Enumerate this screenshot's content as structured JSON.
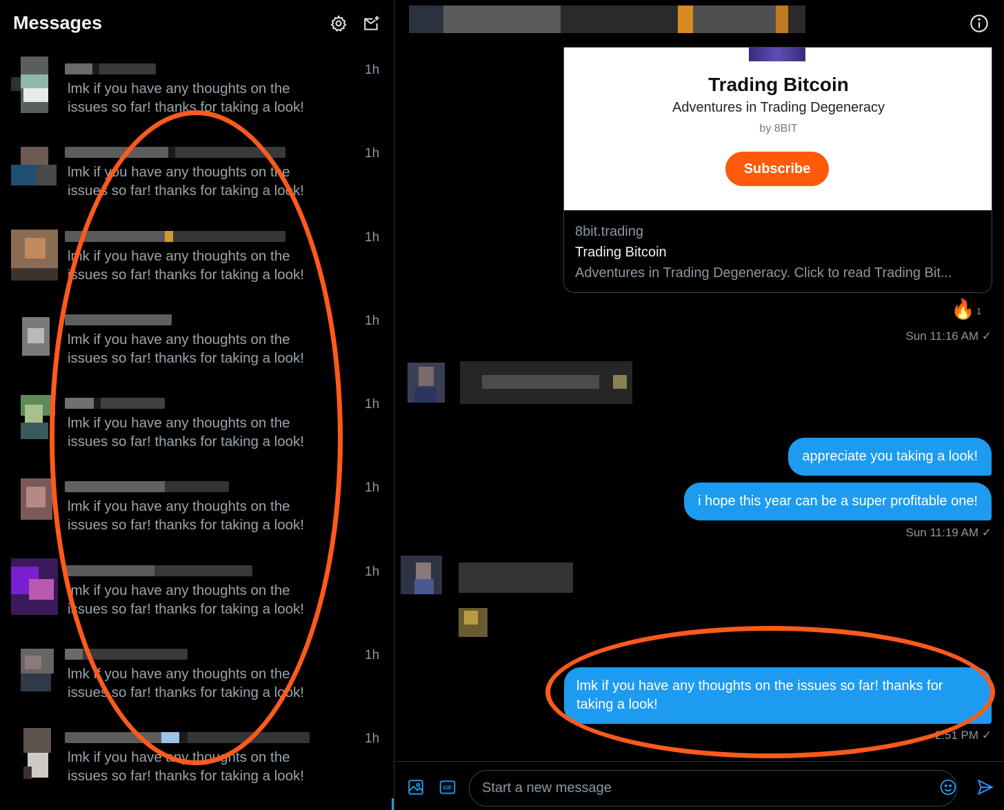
{
  "sidebar": {
    "title": "Messages",
    "settings_icon": "gear-icon",
    "compose_icon": "new-message-icon",
    "conversations": [
      {
        "time": "1h",
        "preview": "lmk if you have any thoughts on the issues so far! thanks for taking a look!"
      },
      {
        "time": "1h",
        "preview": "lmk if you have any thoughts on the issues so far! thanks for taking a look!"
      },
      {
        "time": "1h",
        "preview": "lmk if you have any thoughts on the issues so far! thanks for taking a look!"
      },
      {
        "time": "1h",
        "preview": "lmk if you have any thoughts on the issues so far! thanks for taking a look!"
      },
      {
        "time": "1h",
        "preview": "lmk if you have any thoughts on the issues so far! thanks for taking a look!"
      },
      {
        "time": "1h",
        "preview": "lmk if you have any thoughts on the issues so far! thanks for taking a look!"
      },
      {
        "time": "1h",
        "preview": "lmk if you have any thoughts on the issues so far! thanks for taking a look!"
      },
      {
        "time": "1h",
        "preview": "lmk if you have any thoughts on the issues so far! thanks for taking a look!"
      },
      {
        "time": "1h",
        "preview": "lmk if you have any thoughts on the issues so far! thanks for taking a look!"
      }
    ]
  },
  "chat": {
    "info_icon": "info-icon",
    "link_card": {
      "title": "Trading Bitcoin",
      "subtitle": "Adventures in Trading Degeneracy",
      "byline": "by 8BIT",
      "subscribe_label": "Subscribe",
      "domain": "8bit.trading",
      "meta_title": "Trading Bitcoin",
      "description": "Adventures in Trading Degeneracy. Click to read Trading Bit..."
    },
    "reaction": {
      "emoji": "🔥",
      "count": "1"
    },
    "messages": [
      {
        "text": "appreciate you taking a look!"
      },
      {
        "text": "i hope this year can be a super profitable one!"
      },
      {
        "text": "lmk if you have any thoughts on the issues so far! thanks for taking a look!"
      }
    ],
    "timestamps": {
      "first": "Sun 11:16 AM ✓",
      "second": "Sun 11:19 AM ✓",
      "third": "2:51 PM ✓"
    },
    "compose": {
      "placeholder": "Start a new message",
      "image_icon": "image-icon",
      "gif_label": "GIF",
      "emoji_icon": "emoji-icon",
      "send_icon": "send-icon"
    }
  },
  "colors": {
    "accent": "#1d9bf0",
    "subscribe": "#ff5a0a",
    "annotation": "#ff5a1c",
    "background": "#000000"
  }
}
